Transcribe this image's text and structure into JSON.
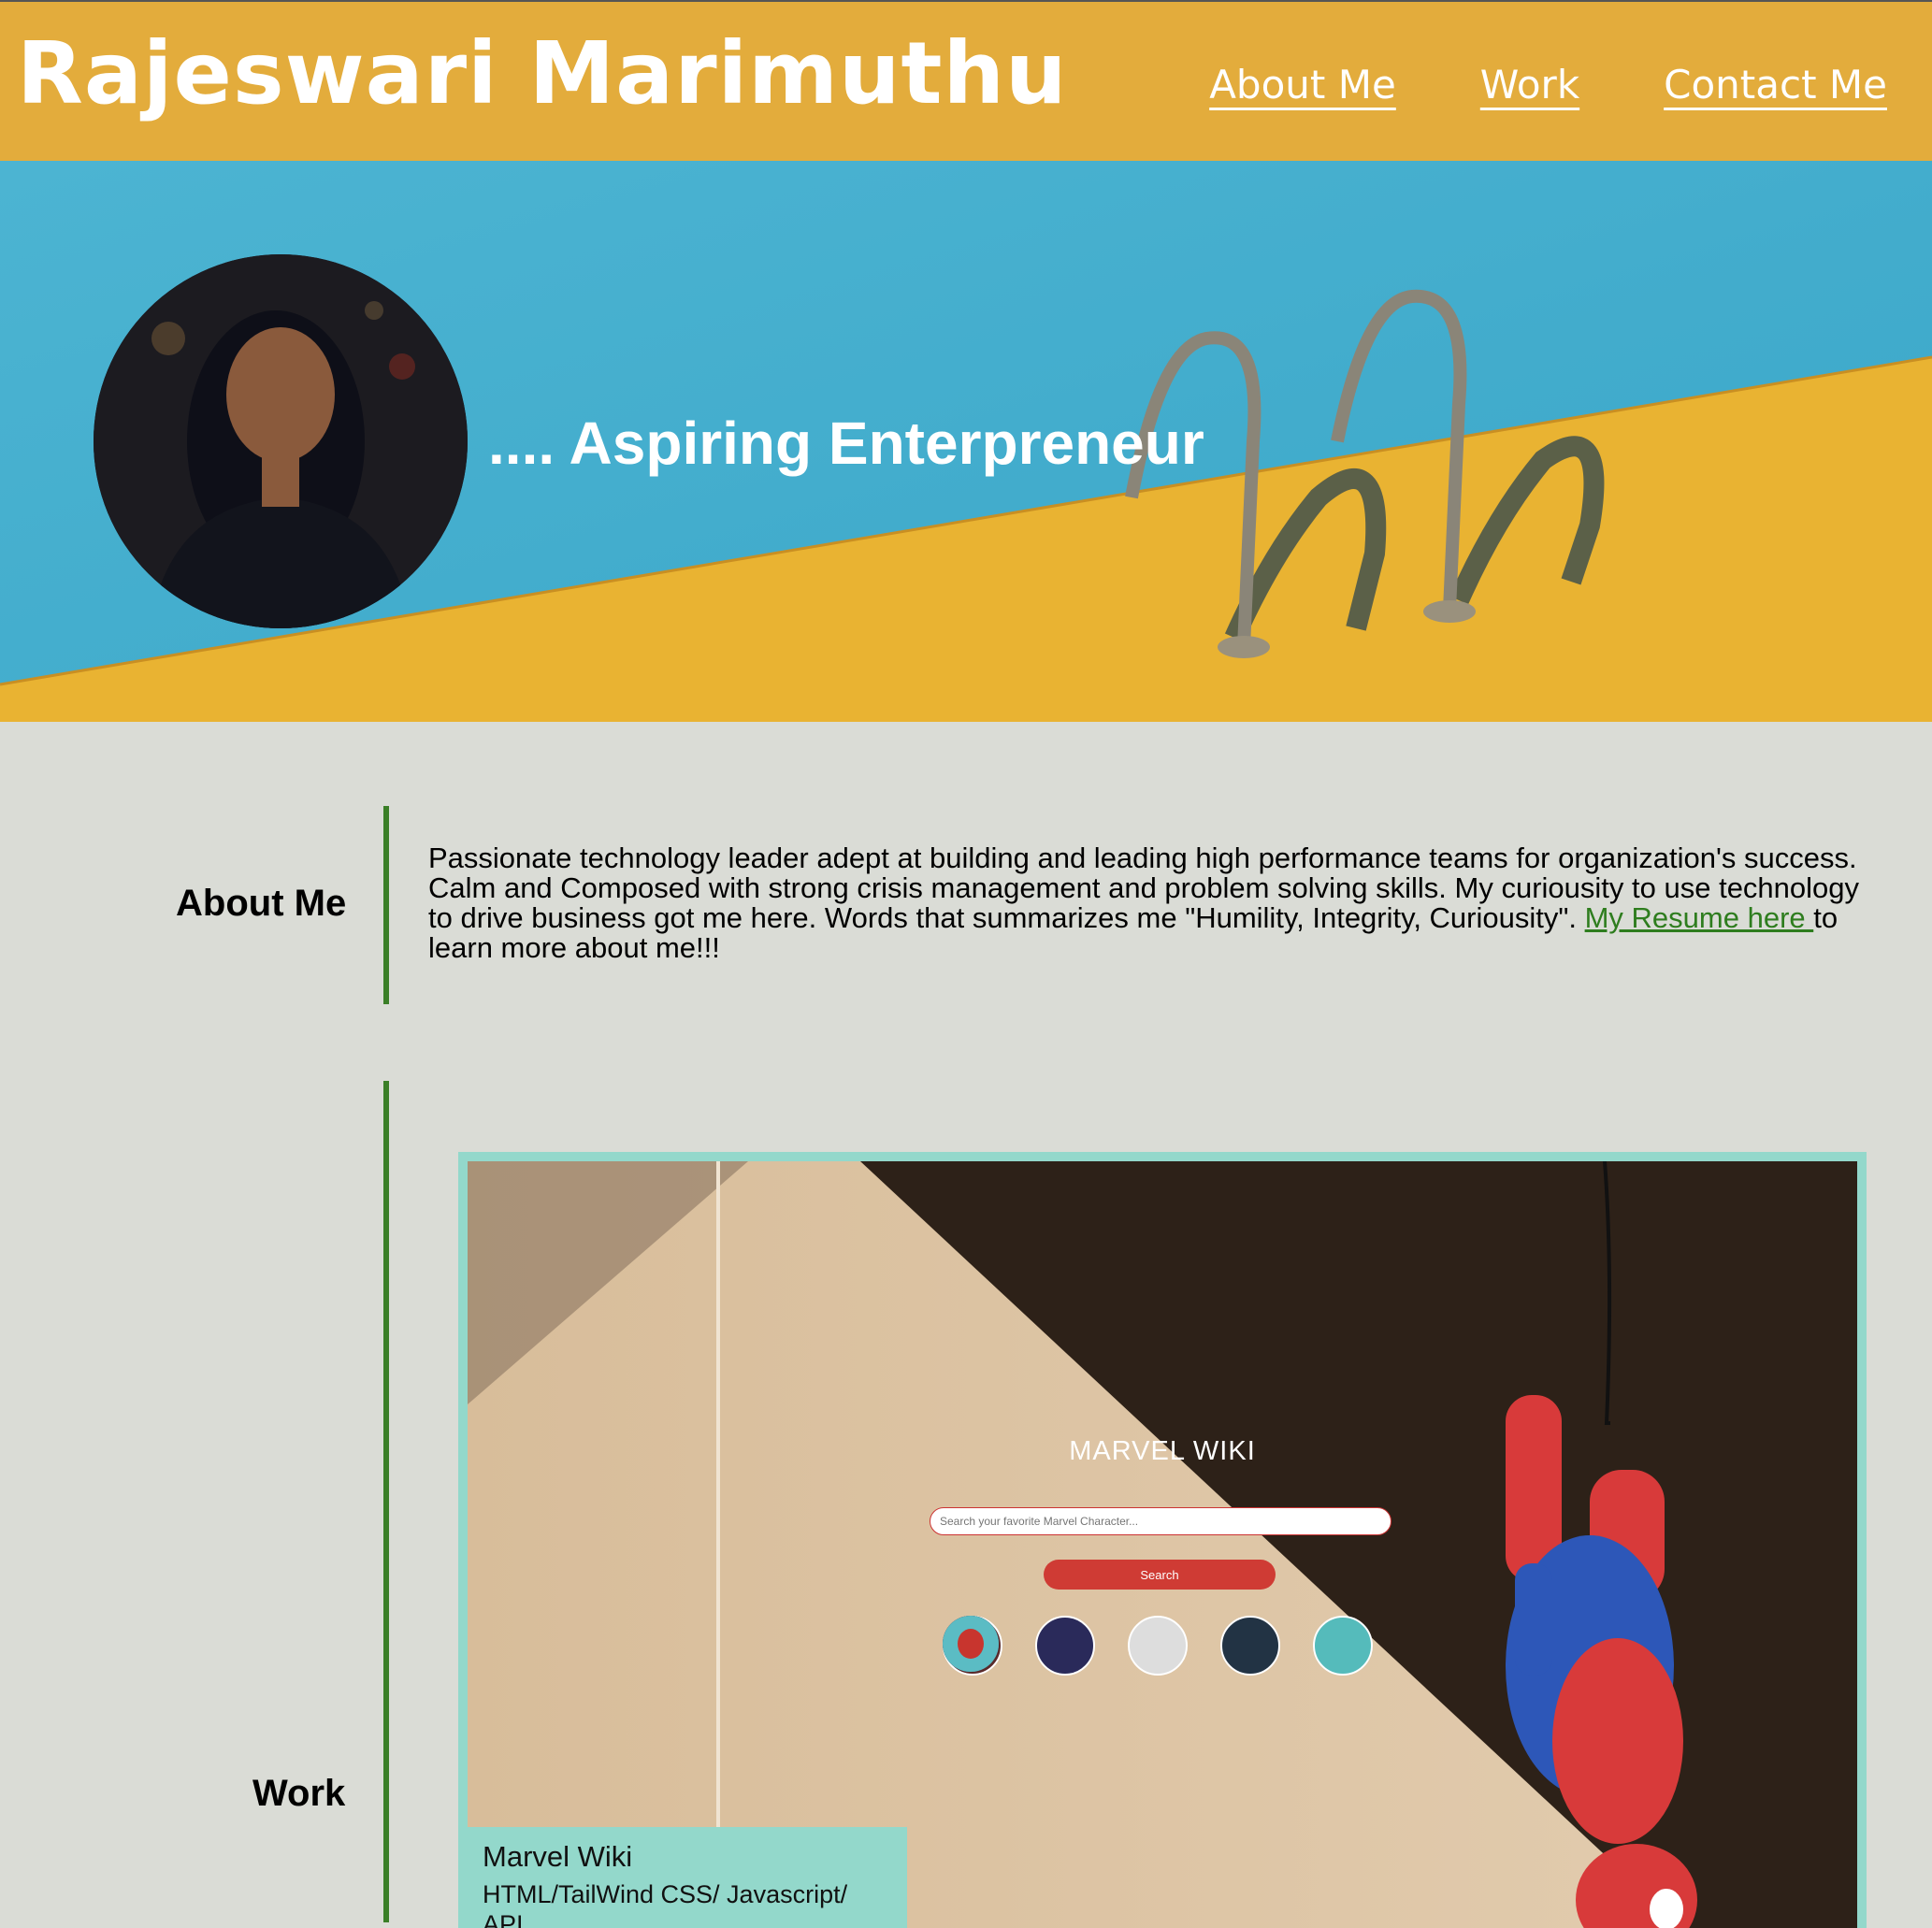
{
  "header": {
    "title": "Rajeswari Marimuthu",
    "nav": [
      "About Me",
      "Work",
      "Contact Me"
    ]
  },
  "hero": {
    "tagline": ".... Aspiring Enterpreneur"
  },
  "about": {
    "label": "About Me",
    "text": "Passionate technology leader adept at building and leading high performance teams for organization's success. Calm and Composed with strong crisis management and problem solving skills. My curiousity to use technology to drive business got me here. Words that summarizes me \"Humility, Integrity, Curiousity\". ",
    "resume_link": "My Resume here ",
    "text_after": "to learn more about me!!!"
  },
  "work": {
    "label": "Work",
    "projects": [
      {
        "title": "Marvel Wiki",
        "tech": "HTML/TailWind CSS/ Javascript/ API",
        "screenshot": {
          "heading": "MARVEL WIKI",
          "search_placeholder": "Search your favorite Marvel Character...",
          "search_button": "Search",
          "hero_icons": [
            "iron-man-icon",
            "black-panther-icon",
            "avengers-icon",
            "hulk-icon",
            "spiderman-icon"
          ]
        }
      }
    ]
  },
  "colors": {
    "header_bg": "#e3ac3c",
    "page_bg": "#dadcd6",
    "accent_green": "#3a7f27",
    "card_border": "#93d8cb",
    "button_red": "#cf3b34"
  }
}
